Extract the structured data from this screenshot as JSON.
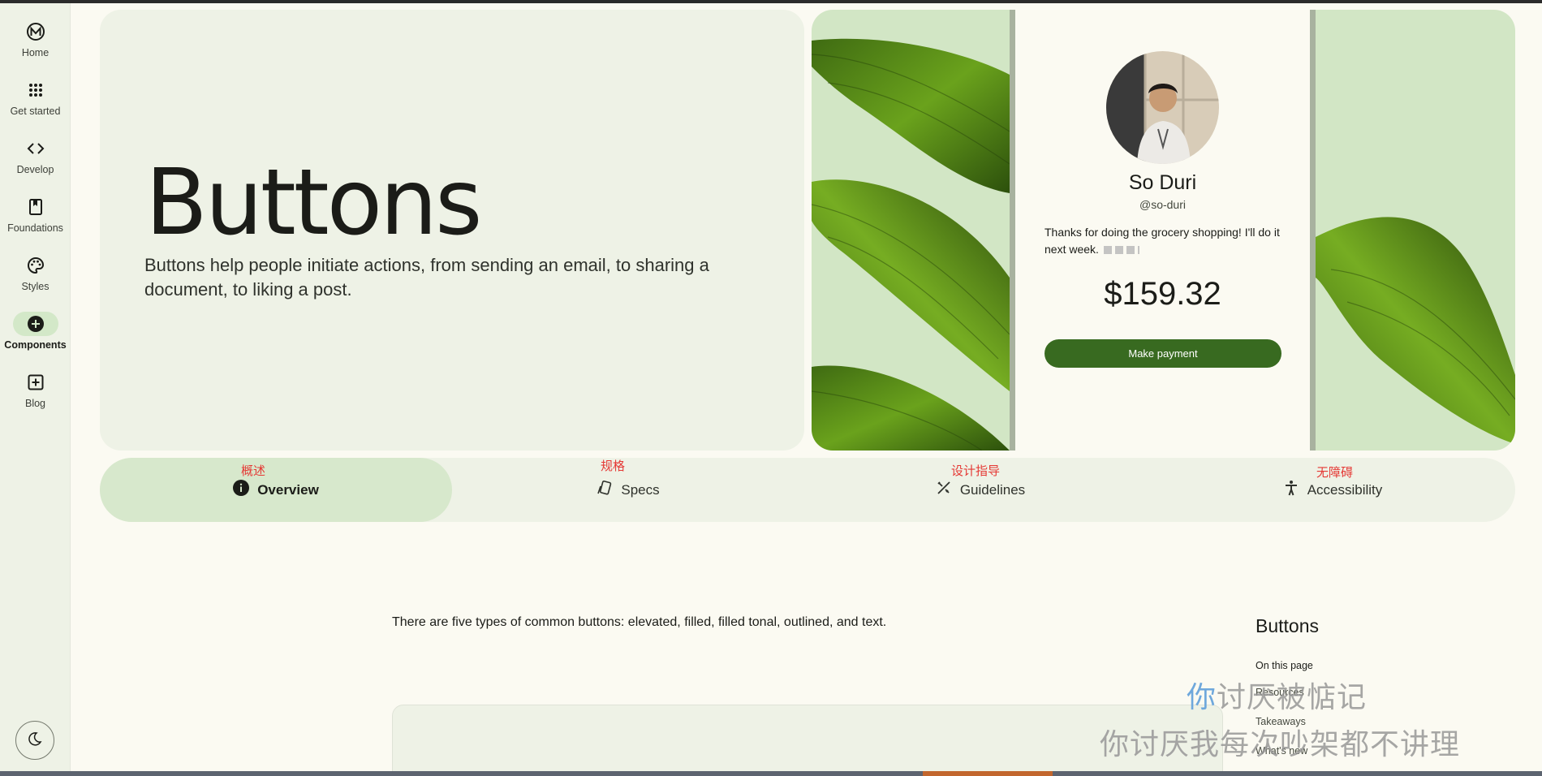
{
  "sidebar": {
    "items": [
      {
        "label": "Home",
        "icon": "material-logo-icon"
      },
      {
        "label": "Get started",
        "icon": "apps-grid-icon"
      },
      {
        "label": "Develop",
        "icon": "code-icon"
      },
      {
        "label": "Foundations",
        "icon": "book-icon"
      },
      {
        "label": "Styles",
        "icon": "palette-icon"
      },
      {
        "label": "Components",
        "icon": "add-circle-icon",
        "active": true
      },
      {
        "label": "Blog",
        "icon": "add-box-icon"
      }
    ],
    "theme_toggle_icon": "moon-icon"
  },
  "hero": {
    "title": "Buttons",
    "description": "Buttons help people initiate actions, from sending an email, to sharing a document, to liking a post."
  },
  "phone": {
    "name": "So Duri",
    "handle": "@so-duri",
    "message": "Thanks for doing the grocery shopping! I'll do it next week.",
    "amount": "$159.32",
    "button_label": "Make payment"
  },
  "tabs": [
    {
      "label": "Overview",
      "cn": "概述",
      "icon": "info-icon",
      "active": true
    },
    {
      "label": "Specs",
      "cn": "规格",
      "icon": "specs-icon"
    },
    {
      "label": "Guidelines",
      "cn": "设计指导",
      "icon": "design-tools-icon"
    },
    {
      "label": "Accessibility",
      "cn": "无障碍",
      "icon": "accessibility-icon"
    }
  ],
  "content": {
    "intro": "There are five types of common buttons: elevated, filled, filled tonal, outlined, and text."
  },
  "toc": {
    "title": "Buttons",
    "caption": "On this page",
    "links": [
      "Resources",
      "Takeaways",
      "What's new"
    ]
  },
  "watermark": {
    "line1_first": "你",
    "line1_rest": "讨厌被惦记",
    "line2": "你讨厌我每次吵架都不讲理"
  },
  "colors": {
    "accent": "#386a20",
    "surface": "#eef2e6",
    "active_tab": "#d7e8cc",
    "annotation": "#e53935"
  }
}
